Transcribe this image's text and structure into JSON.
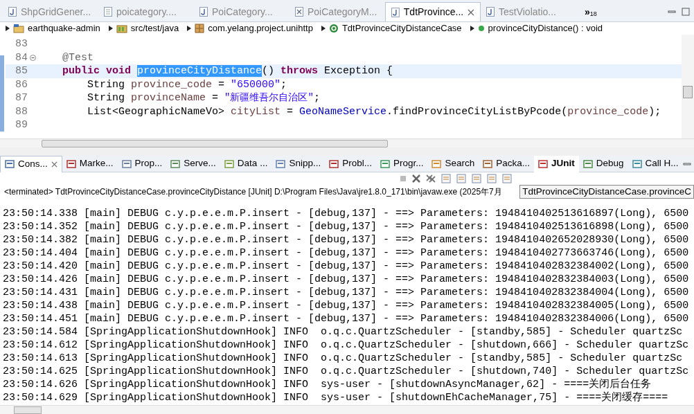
{
  "editor_tabs": [
    {
      "label": "ShpGridGener...",
      "selected": false,
      "kind": "java"
    },
    {
      "label": "poicategory....",
      "selected": false,
      "kind": "file"
    },
    {
      "label": "PoiCategory...",
      "selected": false,
      "kind": "java"
    },
    {
      "label": "PoiCategoryM...",
      "selected": false,
      "kind": "xml"
    },
    {
      "label": "TdtProvince...",
      "selected": true,
      "kind": "java"
    },
    {
      "label": "TestViolatio...",
      "selected": false,
      "kind": "java"
    }
  ],
  "more_tabs": {
    "label": "»",
    "count": "18"
  },
  "breadcrumb": [
    {
      "label": "earthquake-admin",
      "kind": "project"
    },
    {
      "label": "src/test/java",
      "kind": "folder"
    },
    {
      "label": "com.yelang.project.unihttp",
      "kind": "package"
    },
    {
      "label": "TdtProvinceCityDistanceCase",
      "kind": "class"
    },
    {
      "label": "provinceCityDistance() : void",
      "kind": "method"
    }
  ],
  "editor_lines": [
    {
      "number": "83",
      "current": false,
      "fold": false
    },
    {
      "number": "84",
      "current": false,
      "fold": true,
      "tokens": [
        {
          "text": "    @Test",
          "kind": "annotation"
        }
      ]
    },
    {
      "number": "85",
      "current": true,
      "fold": false,
      "tokens": [
        {
          "text": "    public void ",
          "kind": "keyword"
        },
        {
          "text": "provinceCityDistance",
          "kind": "selection"
        },
        {
          "text": "() ",
          "kind": "plain"
        },
        {
          "text": "throws",
          "kind": "keyword"
        },
        {
          "text": " Exception {",
          "kind": "plain"
        }
      ]
    },
    {
      "number": "86",
      "current": false,
      "fold": false,
      "tokens": [
        {
          "text": "        String ",
          "kind": "plain"
        },
        {
          "text": "province_code",
          "kind": "variable"
        },
        {
          "text": " = ",
          "kind": "plain"
        },
        {
          "text": "\"650000\"",
          "kind": "string"
        },
        {
          "text": ";",
          "kind": "plain"
        }
      ]
    },
    {
      "number": "87",
      "current": false,
      "fold": false,
      "tokens": [
        {
          "text": "        String ",
          "kind": "plain"
        },
        {
          "text": "provinceName",
          "kind": "variable"
        },
        {
          "text": " = ",
          "kind": "plain"
        },
        {
          "text": "\"新疆维吾尔自治区\"",
          "kind": "string"
        },
        {
          "text": ";",
          "kind": "plain"
        }
      ]
    },
    {
      "number": "88",
      "current": false,
      "fold": false,
      "tokens": [
        {
          "text": "        List<GeographicNameVo> ",
          "kind": "plain"
        },
        {
          "text": "cityList",
          "kind": "variable"
        },
        {
          "text": " = ",
          "kind": "plain"
        },
        {
          "text": "GeoNameService",
          "kind": "static"
        },
        {
          "text": ".findProvinceCityListByPcode(",
          "kind": "plain"
        },
        {
          "text": "province_code",
          "kind": "variable"
        },
        {
          "text": ");",
          "kind": "plain"
        }
      ]
    },
    {
      "number": "89",
      "current": false,
      "fold": false
    }
  ],
  "view_tabs": [
    {
      "label": "Cons...",
      "selected": true,
      "bold": false,
      "closable": true
    },
    {
      "label": "Marke...",
      "selected": false,
      "bold": false,
      "closable": false
    },
    {
      "label": "Prop...",
      "selected": false,
      "bold": false,
      "closable": false
    },
    {
      "label": "Serve...",
      "selected": false,
      "bold": false,
      "closable": false
    },
    {
      "label": "Data ...",
      "selected": false,
      "bold": false,
      "closable": false
    },
    {
      "label": "Snipp...",
      "selected": false,
      "bold": false,
      "closable": false
    },
    {
      "label": "Probl...",
      "selected": false,
      "bold": false,
      "closable": false
    },
    {
      "label": "Progr...",
      "selected": false,
      "bold": false,
      "closable": false
    },
    {
      "label": "Search",
      "selected": false,
      "bold": false,
      "closable": false
    },
    {
      "label": "Packa...",
      "selected": false,
      "bold": false,
      "closable": false
    },
    {
      "label": "JUnit",
      "selected": false,
      "bold": true,
      "closable": false
    },
    {
      "label": "Debug",
      "selected": false,
      "bold": false,
      "closable": false
    },
    {
      "label": "Call H...",
      "selected": false,
      "bold": false,
      "closable": false
    }
  ],
  "console_status": "<terminated> TdtProvinceCityDistanceCase.provinceCityDistance [JUnit] D:\\Program Files\\Java\\jre1.8.0_171\\bin\\javaw.exe (2025年7月",
  "tooltip": "TdtProvinceCityDistanceCase.provinceC",
  "console_lines": [
    "23:50:14.338 [main] DEBUG c.y.p.e.e.m.P.insert - [debug,137] - ==> Parameters: 1948410402513616897(Long), 6500",
    "23:50:14.352 [main] DEBUG c.y.p.e.e.m.P.insert - [debug,137] - ==> Parameters: 1948410402513616898(Long), 6500",
    "23:50:14.382 [main] DEBUG c.y.p.e.e.m.P.insert - [debug,137] - ==> Parameters: 1948410402652028930(Long), 6500",
    "23:50:14.404 [main] DEBUG c.y.p.e.e.m.P.insert - [debug,137] - ==> Parameters: 1948410402773663746(Long), 6500",
    "23:50:14.420 [main] DEBUG c.y.p.e.e.m.P.insert - [debug,137] - ==> Parameters: 1948410402832384002(Long), 6500",
    "23:50:14.426 [main] DEBUG c.y.p.e.e.m.P.insert - [debug,137] - ==> Parameters: 1948410402832384003(Long), 6500",
    "23:50:14.431 [main] DEBUG c.y.p.e.e.m.P.insert - [debug,137] - ==> Parameters: 1948410402832384004(Long), 6500",
    "23:50:14.438 [main] DEBUG c.y.p.e.e.m.P.insert - [debug,137] - ==> Parameters: 1948410402832384005(Long), 6500",
    "23:50:14.451 [main] DEBUG c.y.p.e.e.m.P.insert - [debug,137] - ==> Parameters: 1948410402832384006(Long), 6500",
    "23:50:14.584 [SpringApplicationShutdownHook] INFO  o.q.c.QuartzScheduler - [standby,585] - Scheduler quartzSc",
    "23:50:14.612 [SpringApplicationShutdownHook] INFO  o.q.c.QuartzScheduler - [shutdown,666] - Scheduler quartzSc",
    "23:50:14.613 [SpringApplicationShutdownHook] INFO  o.q.c.QuartzScheduler - [standby,585] - Scheduler quartzSc",
    "23:50:14.625 [SpringApplicationShutdownHook] INFO  o.q.c.QuartzScheduler - [shutdown,740] - Scheduler quartzSc",
    "23:50:14.626 [SpringApplicationShutdownHook] INFO  sys-user - [shutdownAsyncManager,62] - ====关闭后台任务",
    "23:50:14.629 [SpringApplicationShutdownHook] INFO  sys-user - [shutdownEhCacheManager,75] - ====关闭缓存===="
  ]
}
